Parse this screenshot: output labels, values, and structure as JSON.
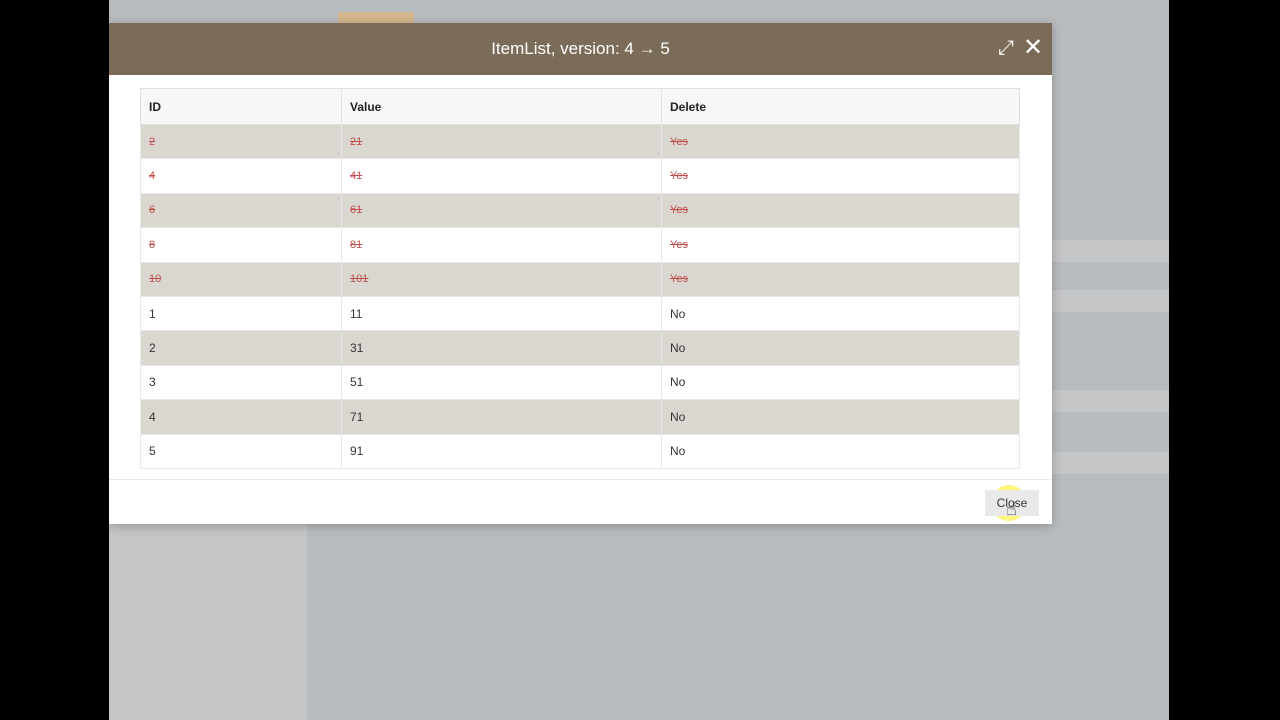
{
  "dialog": {
    "title": "ItemList, version: 4 → 5",
    "expand_icon": "expand-icon",
    "close_icon": "close-icon",
    "close_label": "Close"
  },
  "table": {
    "headers": [
      "ID",
      "Value",
      "Delete"
    ],
    "rows": [
      {
        "id": "2",
        "value": "21",
        "delete": "Yes",
        "deleted": true
      },
      {
        "id": "4",
        "value": "41",
        "delete": "Yes",
        "deleted": true
      },
      {
        "id": "6",
        "value": "61",
        "delete": "Yes",
        "deleted": true
      },
      {
        "id": "8",
        "value": "81",
        "delete": "Yes",
        "deleted": true
      },
      {
        "id": "10",
        "value": "101",
        "delete": "Yes",
        "deleted": true
      },
      {
        "id": "1",
        "value": "11",
        "delete": "No",
        "deleted": false
      },
      {
        "id": "2",
        "value": "31",
        "delete": "No",
        "deleted": false
      },
      {
        "id": "3",
        "value": "51",
        "delete": "No",
        "deleted": false
      },
      {
        "id": "4",
        "value": "71",
        "delete": "No",
        "deleted": false
      },
      {
        "id": "5",
        "value": "91",
        "delete": "No",
        "deleted": false
      }
    ]
  },
  "colors": {
    "header_bg": "#7a6c58",
    "deleted_text": "#c0504d",
    "row_shade": "#dad7d1"
  }
}
